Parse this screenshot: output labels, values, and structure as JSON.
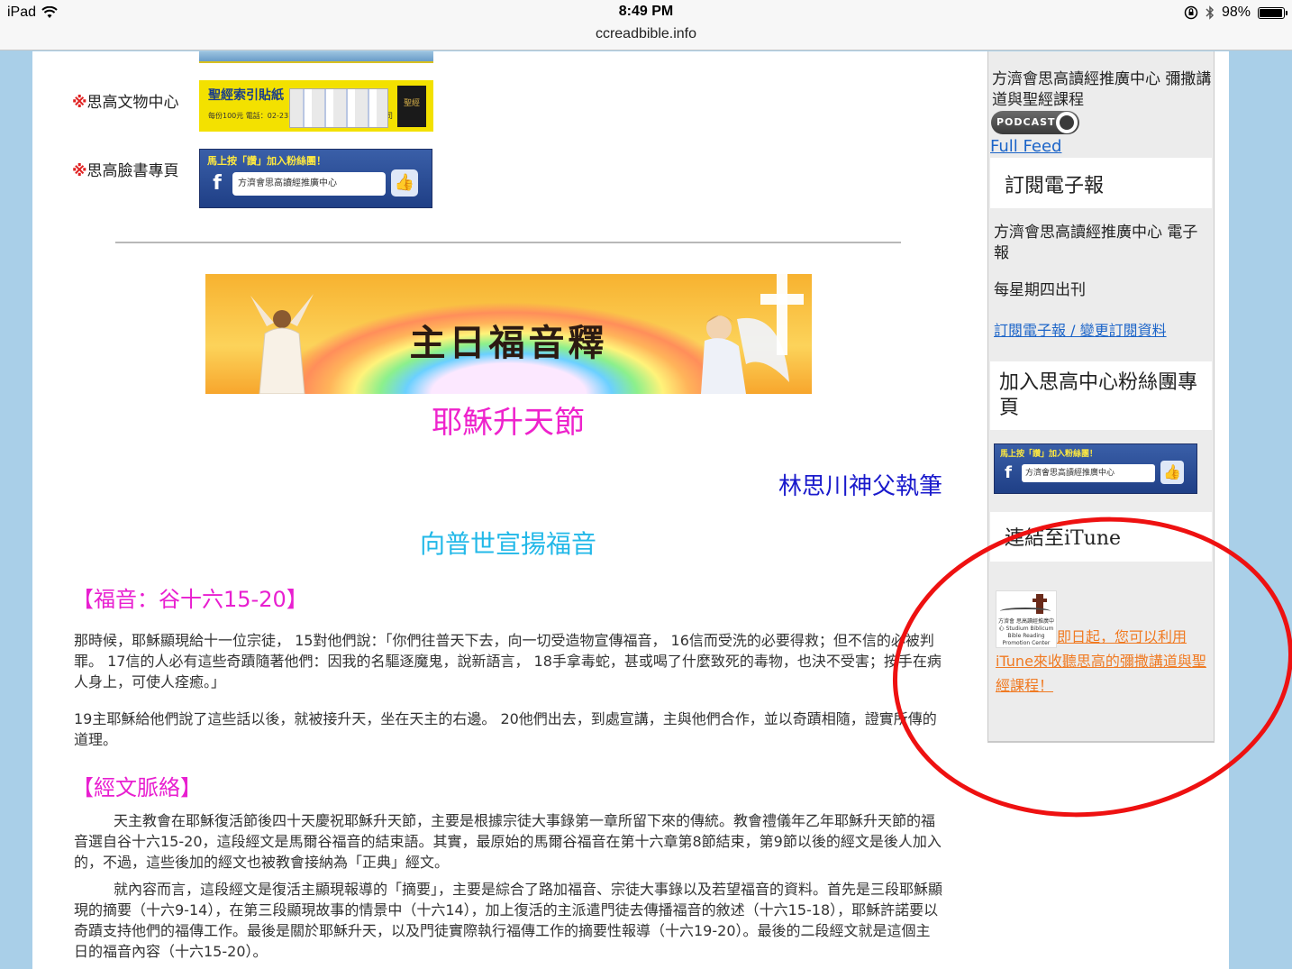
{
  "statusbar": {
    "device": "iPad",
    "time": "8:49 PM",
    "url": "ccreadbible.info",
    "battery_text": "98%",
    "battery_level": 0.98
  },
  "left_links": [
    {
      "mark": "※",
      "label": "思高文物中心"
    },
    {
      "mark": "※",
      "label": "思高臉書專頁"
    }
  ],
  "banners": {
    "bible_title": "聖經索引貼紙",
    "bible_sub": "每份100元  電話：02-2311-2642  佳播企業股份有限公司",
    "bible_book": "聖經",
    "fb_title": "馬上按「讚」加入粉絲團！",
    "fb_f": "f",
    "fb_name": "方濟會思高讀經推廣中心",
    "fb_like": "👍"
  },
  "hero": {
    "title": "主日福音釋"
  },
  "article": {
    "feast_title": "耶穌升天節",
    "author": "林思川神父執筆",
    "theme": "向普世宣揚福音",
    "section_gospel": "【福音：谷十六15-20】",
    "gospel_p1": "那時候，耶穌顯現給十一位宗徒， 15對他們說：「你們往普天下去，向一切受造物宣傳福音， 16信而受洗的必要得救；但不信的必被判罪。 17信的人必有這些奇蹟隨著他們：因我的名驅逐魔鬼，說新語言， 18手拿毒蛇，甚或喝了什麼致死的毒物，也決不受害；按手在病人身上，可使人痊癒。」",
    "gospel_p2": "19主耶穌給他們說了這些話以後，就被接升天，坐在天主的右邊。 20他們出去，到處宣講，主與他們合作，並以奇蹟相隨，證實所傳的道理。",
    "section_context": "【經文脈絡】",
    "context_p1": "天主教會在耶穌復活節後四十天慶祝耶穌升天節，主要是根據宗徒大事錄第一章所留下來的傳統。教會禮儀年乙年耶穌升天節的福音選自谷十六15-20，這段經文是馬爾谷福音的結束語。其實，最原始的馬爾谷福音在第十六章第8節結束，第9節以後的經文是後人加入的，不過，這些後加的經文也被教會接納為「正典」經文。",
    "context_p2": "就內容而言，這段經文是復活主顯現報導的「摘要」，主要是綜合了路加福音、宗徒大事錄以及若望福音的資料。首先是三段耶穌顯現的摘要（十六9-14），在第三段顯現故事的情景中（十六14），加上復活的主派遣門徒去傳播福音的敘述（十六15-18），耶穌許諾要以奇蹟支持他們的福傳工作。最後是關於耶穌升天，以及門徒實際執行福傳工作的摘要性報導（十六19-20）。最後的二段經文就是這個主日的福音內容（十六15-20）。"
  },
  "sidebar": {
    "podcast_title": "方濟會思高讀經推廣中心 彌撒講道與聖經課程",
    "podcast_badge": "PODCAST",
    "full_feed": "Full Feed",
    "ebook_header": "訂閱電子報",
    "ebook_name": "方濟會思高讀經推廣中心 電子報",
    "ebook_freq": "每星期四出刊",
    "ebook_link": "訂閱電子報 / 變更訂閱資料",
    "fans_header": "加入思高中心粉絲團專頁",
    "fb_title": "馬上按「讚」加入粉絲團！",
    "fb_f": "f",
    "fb_name": "方濟會思高讀經推廣中心",
    "fb_like": "👍",
    "itune_header": "連結至iTune",
    "itune_logo_label": "方濟會 思高讀經推廣中心 Studium Biblicum Bible Reading Promotion Center",
    "itune_text": "即日起，您可以利用iTune來收聽思高的彌撒講道與聖經課程！"
  },
  "colors": {
    "annotation": "#ee1111",
    "feast_title": "#ee22cc",
    "author": "#1a1acc",
    "theme": "#22b8e8",
    "section_heading": "#e81fd0",
    "link": "#1b64c8",
    "itune_link": "#f07a22"
  }
}
